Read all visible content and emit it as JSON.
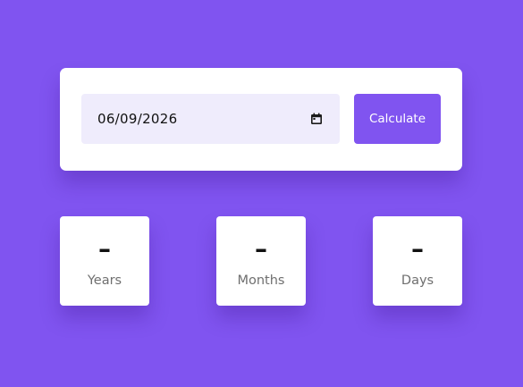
{
  "theme": {
    "background": "#8054f0",
    "accent": "#8054f0",
    "field_background": "#efecfc",
    "card_background": "#ffffff"
  },
  "form": {
    "date_value": "06/09/2026",
    "date_icon": "calendar-icon",
    "calculate_label": "Calculate"
  },
  "results": {
    "years": {
      "value": "–",
      "label": "Years"
    },
    "months": {
      "value": "–",
      "label": "Months"
    },
    "days": {
      "value": "–",
      "label": "Days"
    }
  }
}
